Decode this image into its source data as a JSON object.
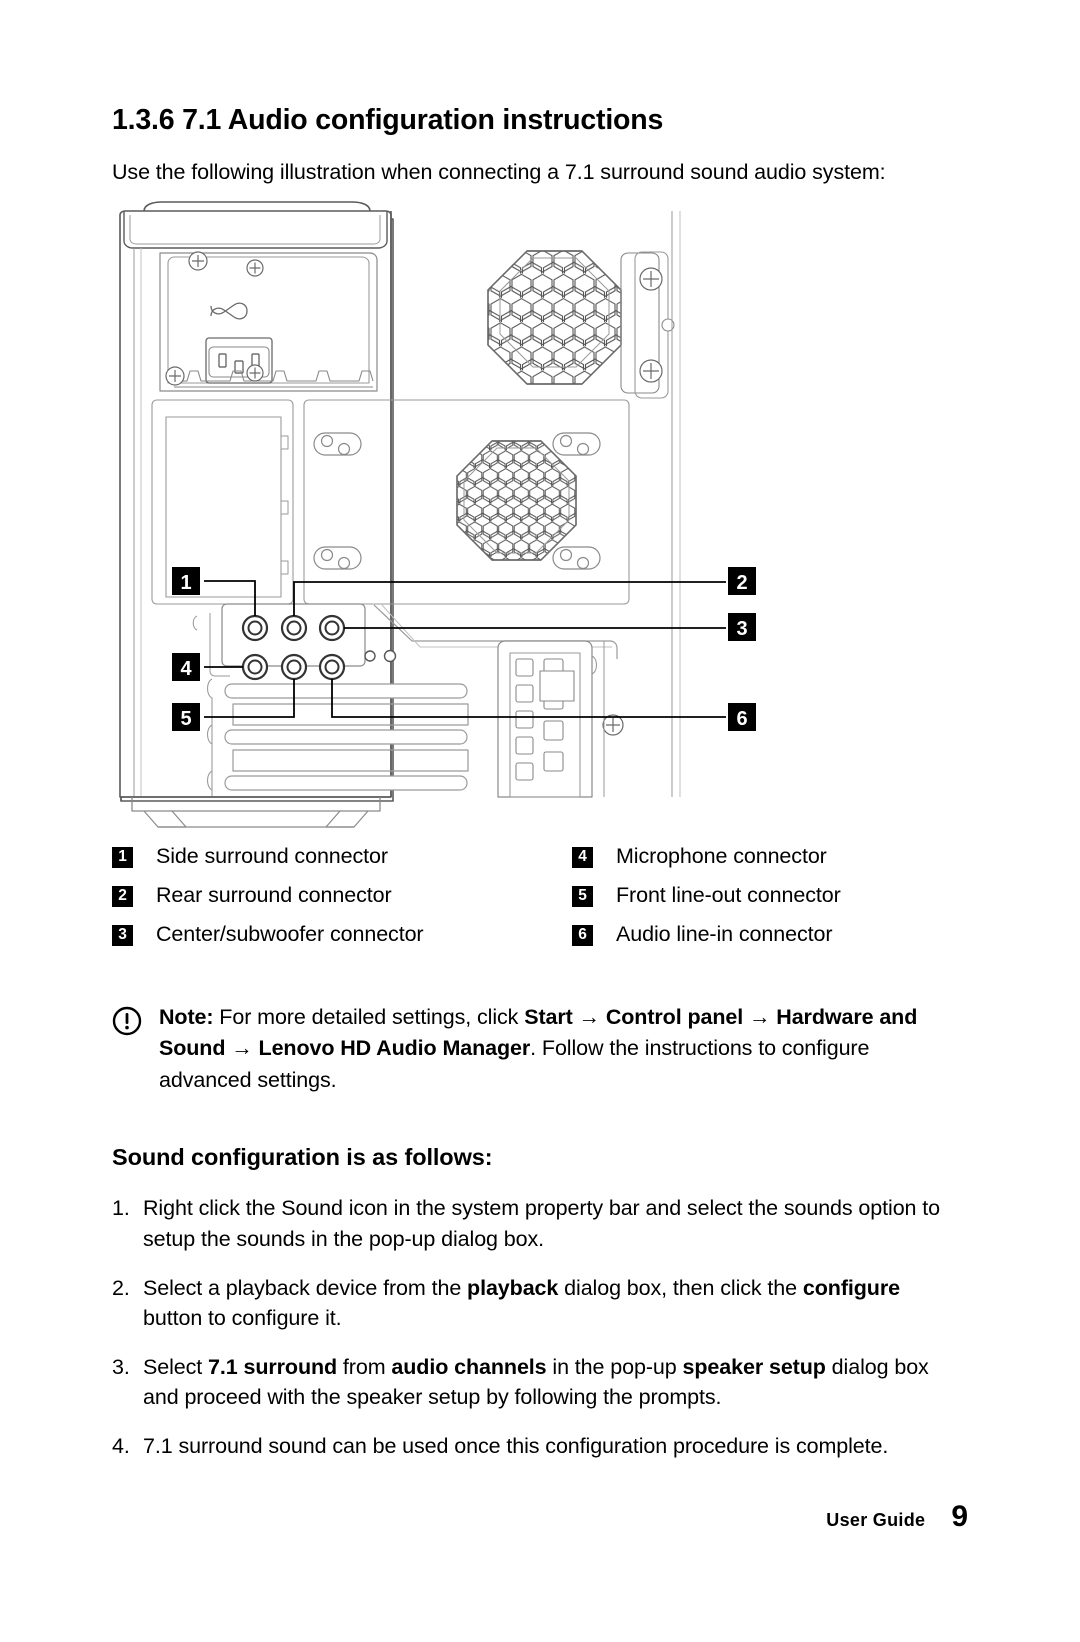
{
  "heading": "1.3.6 7.1 Audio configuration instructions",
  "intro": "Use the following illustration when connecting a 7.1 surround sound audio system:",
  "figure": {
    "name": "computer-rear-panel-illustration",
    "callouts": [
      "1",
      "2",
      "3",
      "4",
      "5",
      "6"
    ]
  },
  "legend": {
    "left": [
      {
        "num": "1",
        "label": "Side surround connector"
      },
      {
        "num": "2",
        "label": "Rear surround connector"
      },
      {
        "num": "3",
        "label": "Center/subwoofer connector"
      }
    ],
    "right": [
      {
        "num": "4",
        "label": "Microphone connector"
      },
      {
        "num": "5",
        "label": "Front line-out connector"
      },
      {
        "num": "6",
        "label": "Audio line-in connector"
      }
    ]
  },
  "note": {
    "icon": "exclamation-circle-icon",
    "prefix": "Note:",
    "part1": " For more detailed settings, click ",
    "bold1": "Start",
    "arrow1": " → ",
    "bold2": "Control panel",
    "arrow2": " → ",
    "bold3": "Hardware and Sound",
    "arrow3": " → ",
    "bold4": "Lenovo HD Audio Manager",
    "part2": ". Follow the instructions to configure advanced settings."
  },
  "subheading": "Sound configuration is as follows:",
  "steps": [
    {
      "num": "1.",
      "segments": [
        {
          "text": "Right click the Sound icon in the system property bar and select the sounds option to setup the sounds in the pop-up dialog box.",
          "bold": false
        }
      ]
    },
    {
      "num": "2.",
      "segments": [
        {
          "text": "Select a playback device from the ",
          "bold": false
        },
        {
          "text": "playback",
          "bold": true
        },
        {
          "text": " dialog box, then click the ",
          "bold": false
        },
        {
          "text": "configure",
          "bold": true
        },
        {
          "text": " button to configure it.",
          "bold": false
        }
      ]
    },
    {
      "num": "3.",
      "segments": [
        {
          "text": "Select ",
          "bold": false
        },
        {
          "text": "7.1 surround",
          "bold": true
        },
        {
          "text": " from ",
          "bold": false
        },
        {
          "text": "audio channels",
          "bold": true
        },
        {
          "text": " in the pop-up ",
          "bold": false
        },
        {
          "text": "speaker setup",
          "bold": true
        },
        {
          "text": " dialog box and proceed with the speaker setup by following the prompts.",
          "bold": false
        }
      ]
    },
    {
      "num": "4.",
      "segments": [
        {
          "text": "7.1 surround sound can be used once this configuration procedure is complete.",
          "bold": false
        }
      ]
    }
  ],
  "footer": {
    "label": "User Guide",
    "page": "9"
  },
  "colors": {
    "text": "#000000",
    "line": "#4a4a4a",
    "badge_bg": "#000000",
    "badge_fg": "#ffffff",
    "page_bg": "#ffffff"
  }
}
